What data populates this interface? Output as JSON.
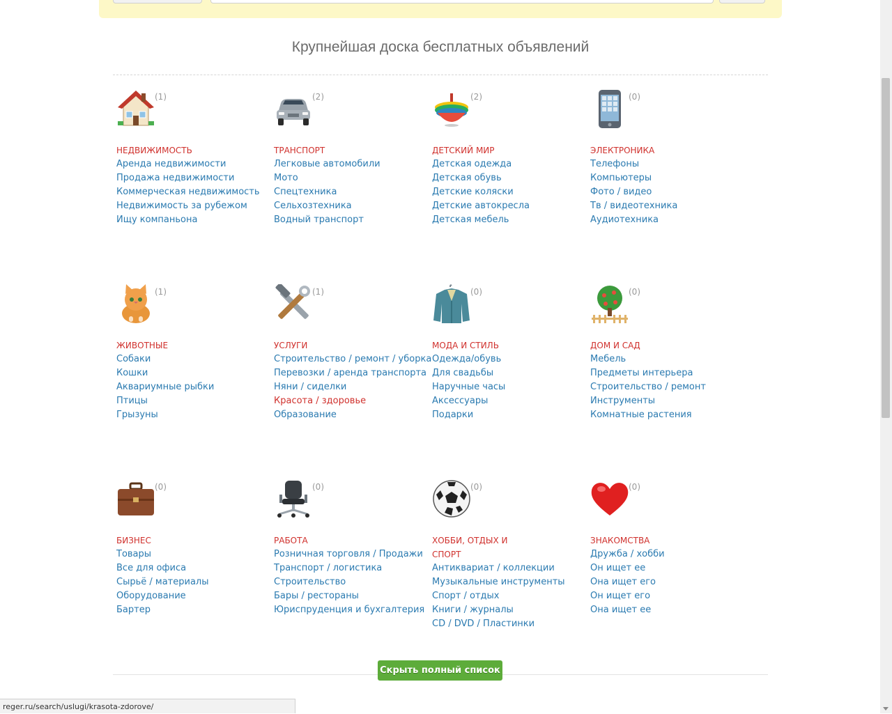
{
  "headline": "Крупнейшая доска бесплатных объявлений",
  "categories": [
    {
      "count": "(1)",
      "title": "НЕДВИЖИМОСТЬ",
      "icon": "house-icon",
      "items": [
        "Аренда недвижимости",
        "Продажа недвижимости",
        "Коммерческая недвижимость",
        "Недвижимость за рубежом",
        "Ищу компаньона"
      ]
    },
    {
      "count": "(2)",
      "title": "ТРАНСПОРТ",
      "icon": "car-icon",
      "items": [
        "Легковые автомобили",
        "Мото",
        "Спецтехника",
        "Сельхозтехника",
        "Водный транспорт"
      ]
    },
    {
      "count": "(2)",
      "title": "ДЕТСКИЙ МИР",
      "icon": "spinning-top-icon",
      "items": [
        "Детская одежда",
        "Детская обувь",
        "Детские коляски",
        "Детские автокресла",
        "Детская мебель"
      ]
    },
    {
      "count": "(0)",
      "title": "ЭЛЕКТРОНИКА",
      "icon": "phone-icon",
      "items": [
        "Телефоны",
        "Компьютеры",
        "Фото / видео",
        "Тв / видеотехника",
        "Аудиотехника"
      ]
    },
    {
      "count": "(1)",
      "title": "ЖИВОТНЫЕ",
      "icon": "cat-icon",
      "items": [
        "Собаки",
        "Кошки",
        "Аквариумные рыбки",
        "Птицы",
        "Грызуны"
      ]
    },
    {
      "count": "(1)",
      "title": "УСЛУГИ",
      "icon": "tools-icon",
      "items": [
        "Строительство / ремонт / уборка",
        "Перевозки / аренда транспорта",
        "Няни / сиделки",
        "Красота / здоровье",
        "Образование"
      ]
    },
    {
      "count": "(0)",
      "title": "МОДА И СТИЛЬ",
      "icon": "jacket-icon",
      "items": [
        "Одежда/обувь",
        "Для свадьбы",
        "Наручные часы",
        "Аксессуары",
        "Подарки"
      ]
    },
    {
      "count": "(0)",
      "title": "ДОМ И САД",
      "icon": "tree-icon",
      "items": [
        "Мебель",
        "Предметы интерьера",
        "Строительство / ремонт",
        "Инструменты",
        "Комнатные растения"
      ]
    },
    {
      "count": "(0)",
      "title": "БИЗНЕС",
      "icon": "briefcase-icon",
      "items": [
        "Товары",
        "Все для офиса",
        "Сырьё / материалы",
        "Оборудование",
        "Бартер"
      ]
    },
    {
      "count": "(0)",
      "title": "РАБОТА",
      "icon": "office-chair-icon",
      "items": [
        "Розничная торговля / Продажи",
        "Транспорт / логистика",
        "Строительство",
        "Бары / рестораны",
        "Юриспруденция и бухгалтерия"
      ]
    },
    {
      "count": "(0)",
      "title": "ХОББИ, ОТДЫХ И СПОРТ",
      "icon": "soccer-ball-icon",
      "items": [
        "Антиквариат / коллекции",
        "Музыкальные инструменты",
        "Спорт / отдых",
        "Книги / журналы",
        "CD / DVD / Пластинки"
      ]
    },
    {
      "count": "(0)",
      "title": "ЗНАКОМСТВА",
      "icon": "heart-icon",
      "items": [
        "Дружба / хобби",
        "Он ищет ее",
        "Она ищет его",
        "Он ищет его",
        "Она ищет ее"
      ]
    }
  ],
  "hide_button": "Скрыть полный список",
  "status_url": "reger.ru/search/uslugi/krasota-zdorove/",
  "colors": {
    "link": "#2a7ab0",
    "category": "#d0312d",
    "button": "#5dac3a",
    "banner": "#fdf8c7"
  }
}
